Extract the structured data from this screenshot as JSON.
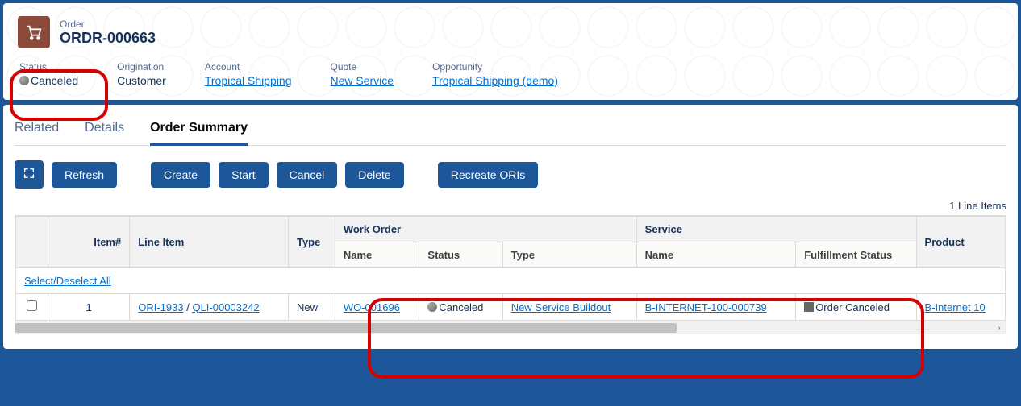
{
  "header": {
    "entity_label": "Order",
    "title": "ORDR-000663",
    "fields": {
      "status_label": "Status",
      "status_value": "Canceled",
      "origination_label": "Origination",
      "origination_value": "Customer",
      "account_label": "Account",
      "account_value": "Tropical Shipping",
      "quote_label": "Quote",
      "quote_value": "New Service",
      "opportunity_label": "Opportunity",
      "opportunity_value": "Tropical Shipping (demo)"
    }
  },
  "tabs": {
    "related": "Related",
    "details": "Details",
    "order_summary": "Order Summary"
  },
  "actions": {
    "refresh": "Refresh",
    "create": "Create",
    "start": "Start",
    "cancel": "Cancel",
    "delete": "Delete",
    "recreate": "Recreate ORIs"
  },
  "summary": {
    "count_text": "1 Line Items",
    "select_all": "Select/Deselect All",
    "columns": {
      "item_no": "Item#",
      "line_item": "Line Item",
      "type": "Type",
      "work_order": "Work Order",
      "wo_name": "Name",
      "wo_status": "Status",
      "wo_type": "Type",
      "service": "Service",
      "svc_name": "Name",
      "fulfillment": "Fulfillment Status",
      "product": "Product"
    },
    "rows": [
      {
        "item_no": "1",
        "ori": "ORI-1933",
        "sep": " / ",
        "qli": "QLI-00003242",
        "type": "New",
        "wo_name": "WO-001696",
        "wo_status": "Canceled",
        "wo_type": "New Service Buildout",
        "svc_name": "B-INTERNET-100-000739",
        "fulfillment": "Order Canceled",
        "product": "B-Internet 10"
      }
    ]
  }
}
